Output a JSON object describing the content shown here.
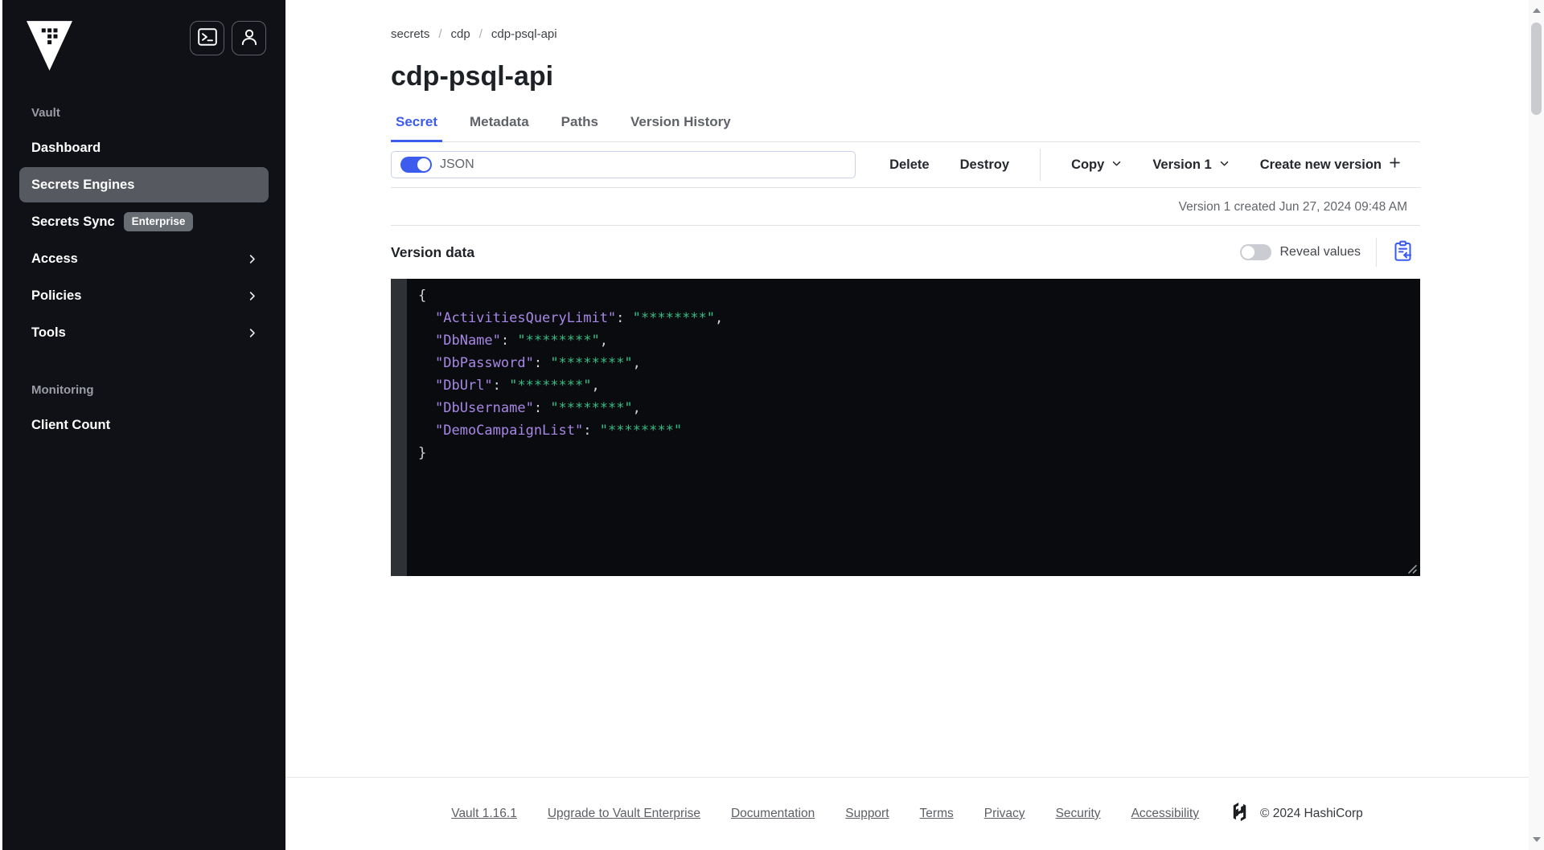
{
  "sidebar": {
    "section_vault": "Vault",
    "items": [
      {
        "label": "Dashboard"
      },
      {
        "label": "Secrets Engines",
        "active": true
      },
      {
        "label": "Secrets Sync",
        "badge": "Enterprise"
      },
      {
        "label": "Access",
        "chevron": true
      },
      {
        "label": "Policies",
        "chevron": true
      },
      {
        "label": "Tools",
        "chevron": true
      }
    ],
    "section_monitoring": "Monitoring",
    "monitoring_items": [
      {
        "label": "Client Count"
      }
    ]
  },
  "header": {
    "breadcrumb": {
      "root": "secrets",
      "middle": "cdp",
      "current": "cdp-psql-api",
      "separator": "/"
    },
    "title": "cdp-psql-api",
    "tabs": [
      {
        "label": "Secret",
        "active": true
      },
      {
        "label": "Metadata"
      },
      {
        "label": "Paths"
      },
      {
        "label": "Version History"
      }
    ]
  },
  "toolbar": {
    "json_toggle_label": "JSON",
    "json_toggle_state": "on",
    "delete_label": "Delete",
    "destroy_label": "Destroy",
    "copy_label": "Copy",
    "version_label": "Version 1",
    "create_label": "Create new version"
  },
  "version_meta": "Version 1 created Jun 27, 2024 09:48 AM",
  "version_data": {
    "heading": "Version data",
    "reveal_label": "Reveal values",
    "reveal_state": "off",
    "json": {
      "open_brace": "{",
      "close_brace": "}",
      "entries": [
        {
          "key": "\"ActivitiesQueryLimit\"",
          "sep": ": ",
          "value": "\"********\"",
          "comma": ","
        },
        {
          "key": "\"DbName\"",
          "sep": ": ",
          "value": "\"********\"",
          "comma": ","
        },
        {
          "key": "\"DbPassword\"",
          "sep": ": ",
          "value": "\"********\"",
          "comma": ","
        },
        {
          "key": "\"DbUrl\"",
          "sep": ": ",
          "value": "\"********\"",
          "comma": ","
        },
        {
          "key": "\"DbUsername\"",
          "sep": ": ",
          "value": "\"********\"",
          "comma": ","
        },
        {
          "key": "\"DemoCampaignList\"",
          "sep": ": ",
          "value": "\"********\"",
          "comma": ""
        }
      ]
    }
  },
  "footer": {
    "links": [
      "Vault 1.16.1",
      "Upgrade to Vault Enterprise",
      "Documentation",
      "Support",
      "Terms",
      "Privacy",
      "Security",
      "Accessibility"
    ],
    "copyright": "© 2024 HashiCorp"
  },
  "colors": {
    "accent_blue": "#3b5ced",
    "sidebar_bg": "#101116",
    "sidebar_active_pill": "#56595f",
    "code_bg": "#0a0b0e",
    "code_key": "#a787e5",
    "code_value": "#35bd85"
  }
}
